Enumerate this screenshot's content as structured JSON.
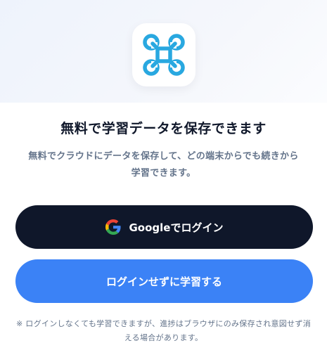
{
  "header": {
    "logo_icon": "drone-icon",
    "logo_color": "#29a8e0"
  },
  "main": {
    "title": "無料で学習データを保存できます",
    "subtitle": "無料でクラウドにデータを保存して、どの端末からでも続きから学習できます。"
  },
  "actions": {
    "google_icon": "google-g-icon",
    "google_label": "Googleでログイン",
    "guest_label": "ログインせずに学習する"
  },
  "footer": {
    "note": "※ ログインしなくても学習できますが、進捗はブラウザにのみ保存され意図せず消える場合があります。"
  },
  "colors": {
    "primary_dark": "#0f172a",
    "accent_blue": "#3b82f6",
    "muted_text": "#64748b"
  }
}
